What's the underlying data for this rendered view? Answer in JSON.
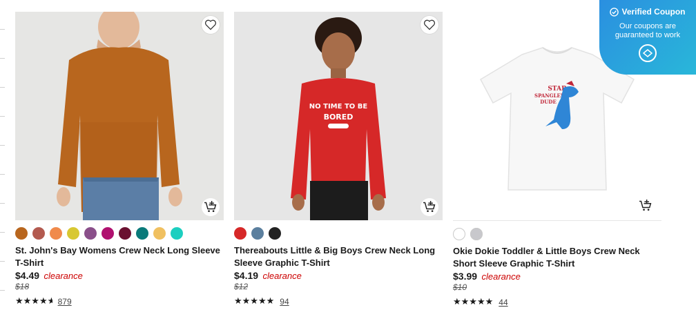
{
  "products": [
    {
      "title": "St. John's Bay Womens Crew Neck Long Sleeve T-Shirt",
      "price": "$4.49",
      "price_tag": "clearance",
      "original_price": "$18",
      "rating_stars": 4.5,
      "review_count": "879",
      "swatches": [
        "#b8661e",
        "#b35a4f",
        "#f08a4b",
        "#d8c832",
        "#8a4f8a",
        "#b0106f",
        "#6a1030",
        "#0a7a7a",
        "#f0c060",
        "#1ccfc0"
      ]
    },
    {
      "title": "Thereabouts Little & Big Boys Crew Neck Long Sleeve Graphic T-Shirt",
      "price": "$4.19",
      "price_tag": "clearance",
      "original_price": "$12",
      "rating_stars": 5,
      "review_count": "94",
      "swatches": [
        "#d62828",
        "#5b7f9e",
        "#222222"
      ],
      "shirt_text_1": "NO TIME TO BE",
      "shirt_text_2": "BORED"
    },
    {
      "title": "Okie Dokie Toddler & Little Boys Crew Neck Short Sleeve Graphic T-Shirt",
      "price": "$3.99",
      "price_tag": "clearance",
      "original_price": "$10",
      "rating_stars": 5,
      "review_count": "44",
      "swatches": [
        "#ffffff",
        "#c8c8cc"
      ],
      "shirt_text_1": "STAR",
      "shirt_text_2": "SPANGLED",
      "shirt_text_3": "DUDE"
    }
  ],
  "coupon": {
    "title": "Verified Coupon",
    "subtitle": "Our coupons are guaranteed to work"
  },
  "icons": {
    "favorite": "heart-icon",
    "cart": "add-to-cart-icon",
    "verified": "check-circle-icon",
    "logo": "coupon-logo-icon"
  },
  "colors": {
    "clearance": "#cc0000",
    "coupon_gradient_start": "#2a8fe0",
    "coupon_gradient_end": "#29b7d9"
  }
}
